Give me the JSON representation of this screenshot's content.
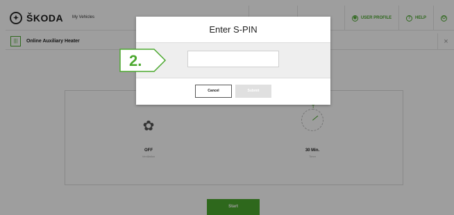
{
  "header": {
    "brand": "ŠKODA",
    "my_vehicles": "My Vehicles",
    "nav_blank1": "",
    "nav_blank2": "",
    "user_profile": "USER PROFILE",
    "help": "HELP"
  },
  "subheader": {
    "title": "Online Auxiliary Heater",
    "close": "×"
  },
  "main": {
    "fan_state": "OFF",
    "fan_label": "Ventilation",
    "timer_state": "30 Min.",
    "timer_label": "Timer",
    "start_label": "Start"
  },
  "modal": {
    "title": "Enter S-PIN",
    "input_value": "",
    "cancel_label": "Cancel",
    "submit_label": "Submit"
  },
  "callout": {
    "step": "2."
  },
  "colors": {
    "accent": "#4ba82e",
    "overlay": "rgba(0,0,0,0.38)"
  }
}
